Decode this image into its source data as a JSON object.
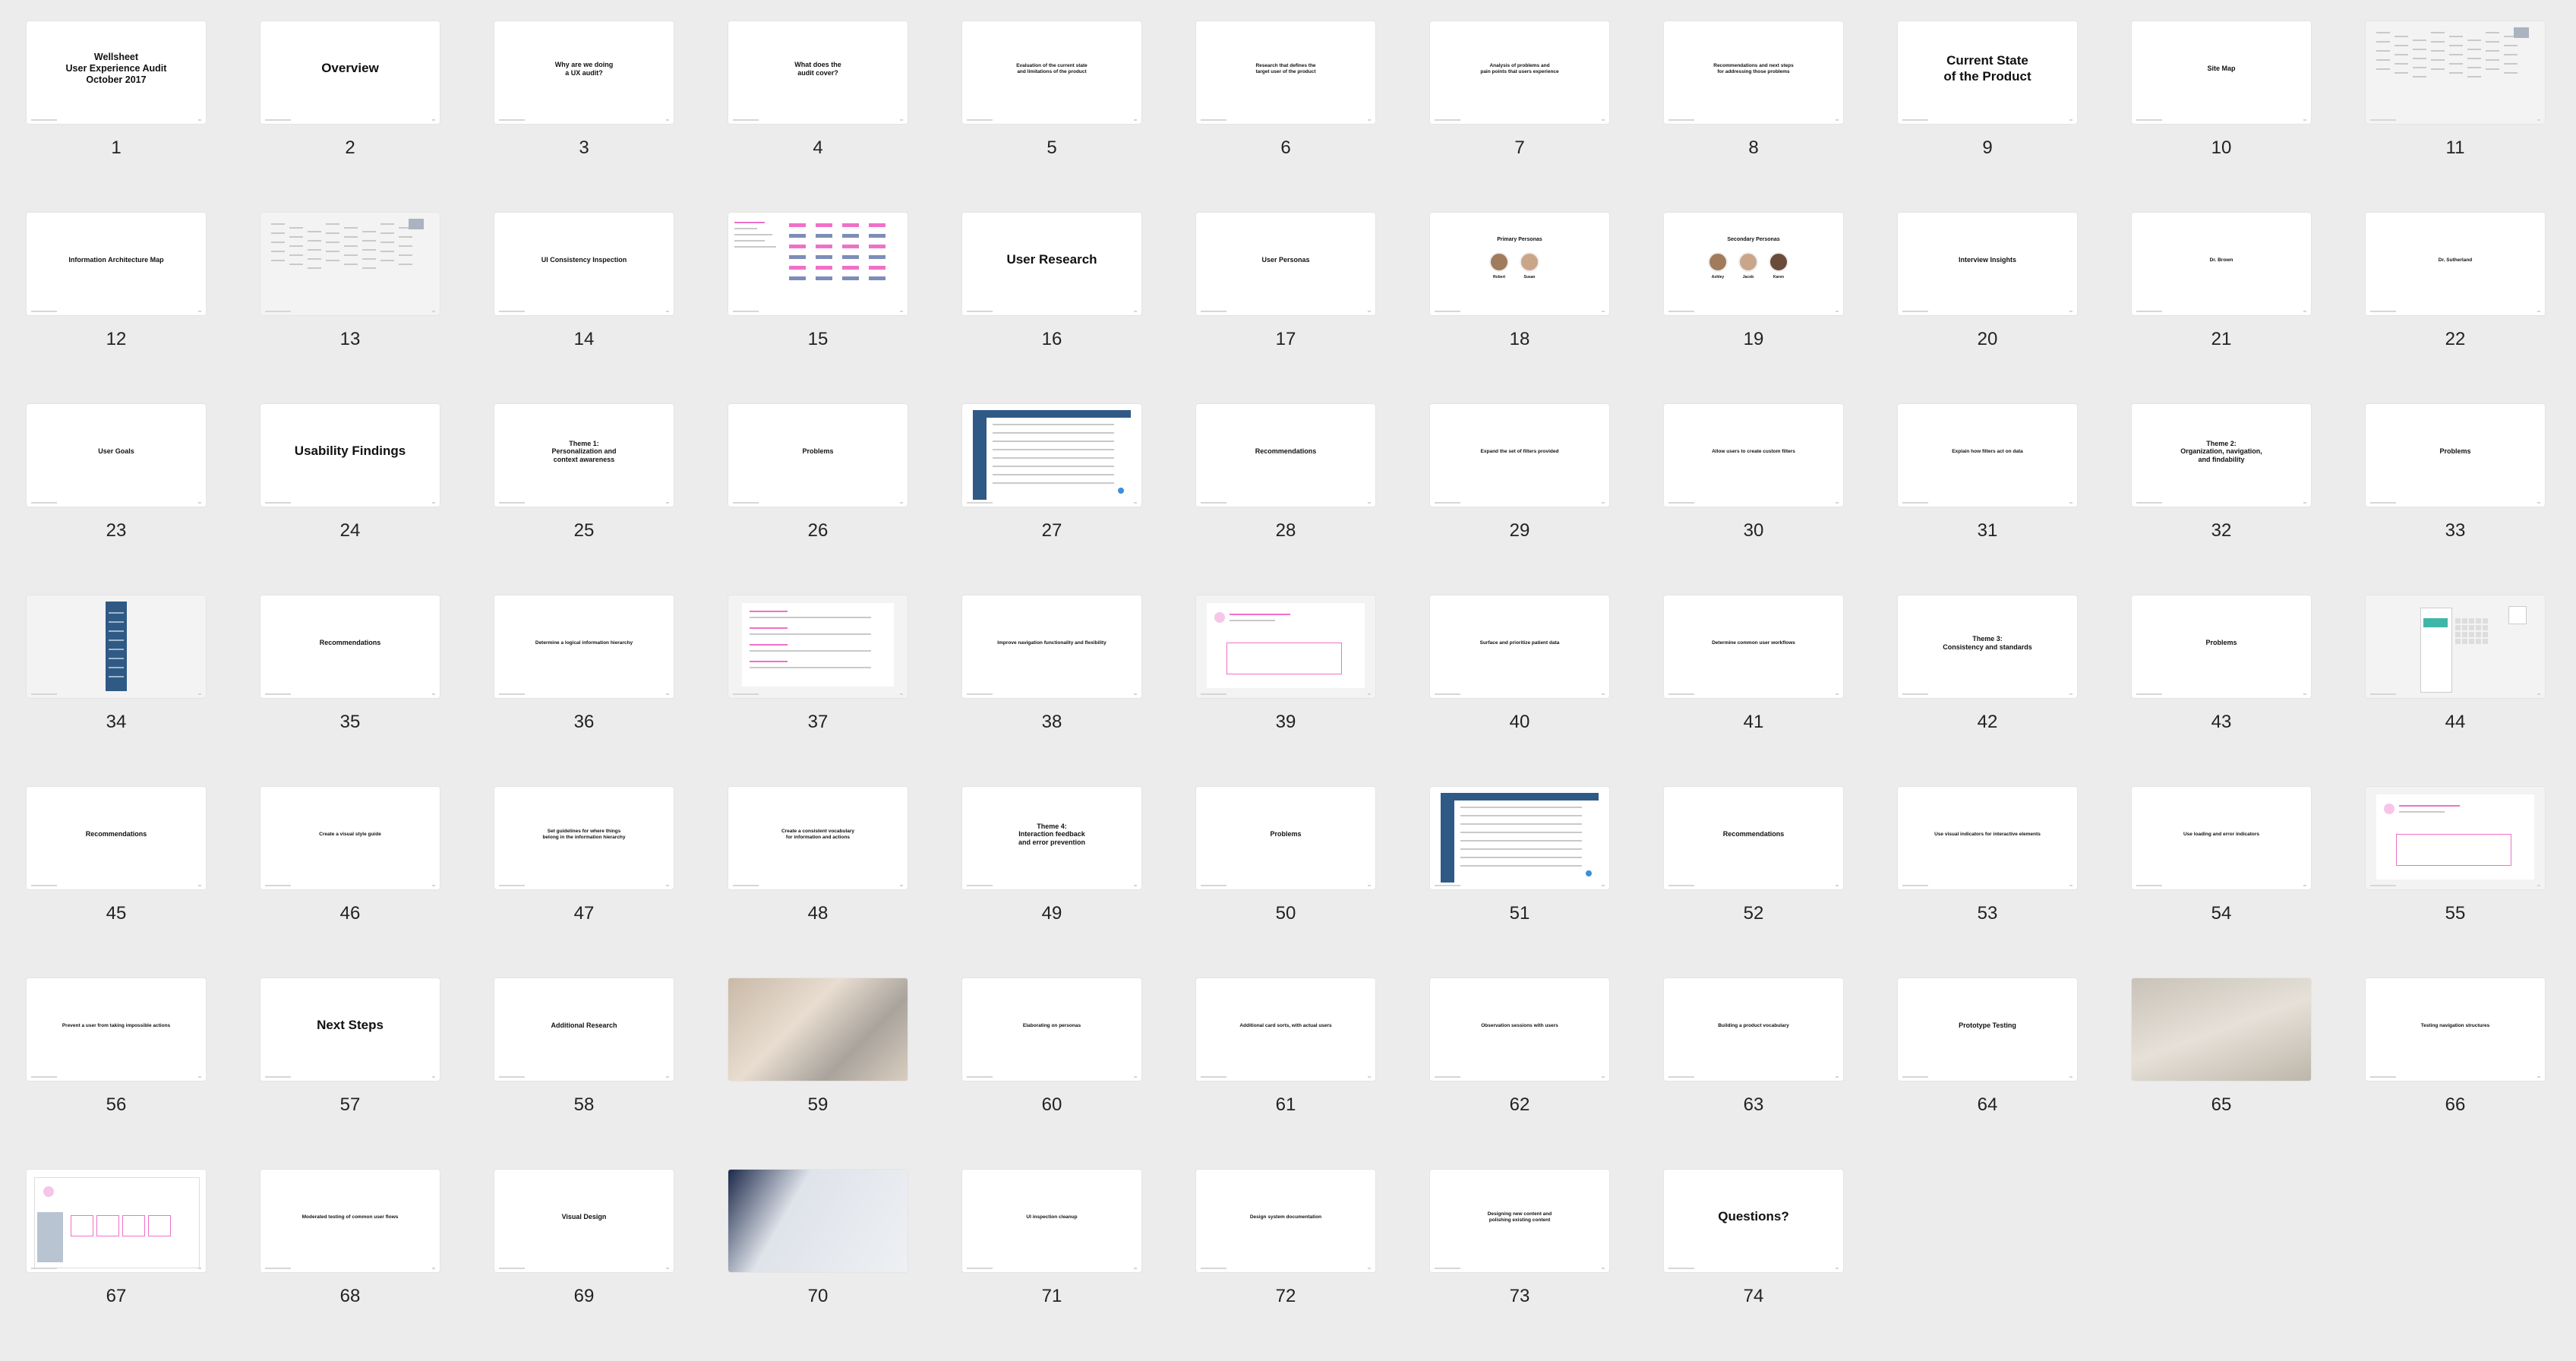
{
  "slides": [
    {
      "n": "1",
      "title": "Wellsheet\nUser Experience Audit\nOctober 2017",
      "size": "md"
    },
    {
      "n": "2",
      "title": "Overview",
      "size": "lg"
    },
    {
      "n": "3",
      "title": "Why are we doing\na UX audit?",
      "size": "sm"
    },
    {
      "n": "4",
      "title": "What does the\naudit cover?",
      "size": "sm"
    },
    {
      "n": "5",
      "title": "Evaluation of the current state\nand limitations of the product",
      "size": "xs"
    },
    {
      "n": "6",
      "title": "Research that defines the\ntarget user of the product",
      "size": "xs"
    },
    {
      "n": "7",
      "title": "Analysis of problems and\npain points that users experience",
      "size": "xs"
    },
    {
      "n": "8",
      "title": "Recommendations and next steps\nfor addressing those problems",
      "size": "xs"
    },
    {
      "n": "9",
      "title": "Current State\nof the Product",
      "size": "lg"
    },
    {
      "n": "10",
      "title": "Site Map",
      "size": "sm"
    },
    {
      "n": "11",
      "title": "",
      "size": "sm",
      "art": "sitemap"
    },
    {
      "n": "12",
      "title": "Information Architecture Map",
      "size": "sm"
    },
    {
      "n": "13",
      "title": "",
      "size": "sm",
      "art": "iamap"
    },
    {
      "n": "14",
      "title": "UI Consistency Inspection",
      "size": "sm"
    },
    {
      "n": "15",
      "title": "",
      "size": "sm",
      "art": "inspection"
    },
    {
      "n": "16",
      "title": "User Research",
      "size": "lg"
    },
    {
      "n": "17",
      "title": "User Personas",
      "size": "sm"
    },
    {
      "n": "18",
      "title": "",
      "size": "sm",
      "art": "primary"
    },
    {
      "n": "19",
      "title": "",
      "size": "sm",
      "art": "secondary"
    },
    {
      "n": "20",
      "title": "Interview Insights",
      "size": "sm"
    },
    {
      "n": "21",
      "title": "Dr. Brown",
      "size": "xs"
    },
    {
      "n": "22",
      "title": "Dr. Sutherland",
      "size": "xs"
    },
    {
      "n": "23",
      "title": "User Goals",
      "size": "sm"
    },
    {
      "n": "24",
      "title": "Usability Findings",
      "size": "lg"
    },
    {
      "n": "25",
      "title": "Theme 1:\nPersonalization and\ncontext awareness",
      "size": "sm"
    },
    {
      "n": "26",
      "title": "Problems",
      "size": "sm"
    },
    {
      "n": "27",
      "title": "",
      "size": "sm",
      "art": "app"
    },
    {
      "n": "28",
      "title": "Recommendations",
      "size": "sm"
    },
    {
      "n": "29",
      "title": "Expand the set of filters provided",
      "size": "xs"
    },
    {
      "n": "30",
      "title": "Allow users to create custom filters",
      "size": "xs"
    },
    {
      "n": "31",
      "title": "Explain how filters act on data",
      "size": "xs"
    },
    {
      "n": "32",
      "title": "Theme 2:\nOrganization, navigation,\nand findability",
      "size": "sm"
    },
    {
      "n": "33",
      "title": "Problems",
      "size": "sm"
    },
    {
      "n": "34",
      "title": "",
      "size": "sm",
      "art": "tallnav"
    },
    {
      "n": "35",
      "title": "Recommendations",
      "size": "sm"
    },
    {
      "n": "36",
      "title": "Determine a logical information hierarchy",
      "size": "xs"
    },
    {
      "n": "37",
      "title": "",
      "size": "sm",
      "art": "wire1"
    },
    {
      "n": "38",
      "title": "Improve navigation functionality and flexibility",
      "size": "xs"
    },
    {
      "n": "39",
      "title": "",
      "size": "sm",
      "art": "wire2"
    },
    {
      "n": "40",
      "title": "Surface and prioritize patient data",
      "size": "xs"
    },
    {
      "n": "41",
      "title": "Determine common user workflows",
      "size": "xs"
    },
    {
      "n": "42",
      "title": "Theme 3:\nConsistency and standards",
      "size": "sm"
    },
    {
      "n": "43",
      "title": "Problems",
      "size": "sm"
    },
    {
      "n": "44",
      "title": "",
      "size": "sm",
      "art": "calendar"
    },
    {
      "n": "45",
      "title": "Recommendations",
      "size": "sm"
    },
    {
      "n": "46",
      "title": "Create a visual style guide",
      "size": "xs"
    },
    {
      "n": "47",
      "title": "Set guidelines for where things\nbelong in the information hierarchy",
      "size": "xs"
    },
    {
      "n": "48",
      "title": "Create a consistent vocabulary\nfor information and actions",
      "size": "xs"
    },
    {
      "n": "49",
      "title": "Theme 4:\nInteraction feedback\nand error prevention",
      "size": "sm"
    },
    {
      "n": "50",
      "title": "Problems",
      "size": "sm"
    },
    {
      "n": "51",
      "title": "",
      "size": "sm",
      "art": "app2"
    },
    {
      "n": "52",
      "title": "Recommendations",
      "size": "sm"
    },
    {
      "n": "53",
      "title": "Use visual indicators for interactive elements",
      "size": "xs"
    },
    {
      "n": "54",
      "title": "Use loading and error indicators",
      "size": "xs"
    },
    {
      "n": "55",
      "title": "",
      "size": "sm",
      "art": "wire3"
    },
    {
      "n": "56",
      "title": "Prevent a user from taking impossible actions",
      "size": "xs"
    },
    {
      "n": "57",
      "title": "Next Steps",
      "size": "lg"
    },
    {
      "n": "58",
      "title": "Additional Research",
      "size": "sm"
    },
    {
      "n": "59",
      "title": "",
      "size": "sm",
      "art": "photo1"
    },
    {
      "n": "60",
      "title": "Elaborating on personas",
      "size": "xs"
    },
    {
      "n": "61",
      "title": "Additional card sorts, with actual users",
      "size": "xs"
    },
    {
      "n": "62",
      "title": "Observation sessions with users",
      "size": "xs"
    },
    {
      "n": "63",
      "title": "Building a product vocabulary",
      "size": "xs"
    },
    {
      "n": "64",
      "title": "Prototype Testing",
      "size": "sm"
    },
    {
      "n": "65",
      "title": "",
      "size": "sm",
      "art": "photo2"
    },
    {
      "n": "66",
      "title": "Testing navigation structures",
      "size": "xs"
    },
    {
      "n": "67",
      "title": "",
      "size": "sm",
      "art": "wire4"
    },
    {
      "n": "68",
      "title": "Moderated testing of common user flows",
      "size": "xs"
    },
    {
      "n": "69",
      "title": "Visual Design",
      "size": "sm"
    },
    {
      "n": "70",
      "title": "",
      "size": "sm",
      "art": "photo3"
    },
    {
      "n": "71",
      "title": "UI inspection cleanup",
      "size": "xs"
    },
    {
      "n": "72",
      "title": "Design system documentation",
      "size": "xs"
    },
    {
      "n": "73",
      "title": "Designing new content and\npolishing existing content",
      "size": "xs"
    },
    {
      "n": "74",
      "title": "Questions?",
      "size": "lg"
    }
  ],
  "persona_labels": {
    "primary_title": "Primary Personas",
    "primary": [
      "Robert",
      "Susan"
    ],
    "secondary_title": "Secondary Personas",
    "secondary": [
      "Ashley",
      "Jacob",
      "Karen"
    ]
  },
  "colors": {
    "background": "#ececec",
    "slide": "#ffffff",
    "accent_pink": "#f070c8",
    "app_blue": "#2f5a86"
  }
}
